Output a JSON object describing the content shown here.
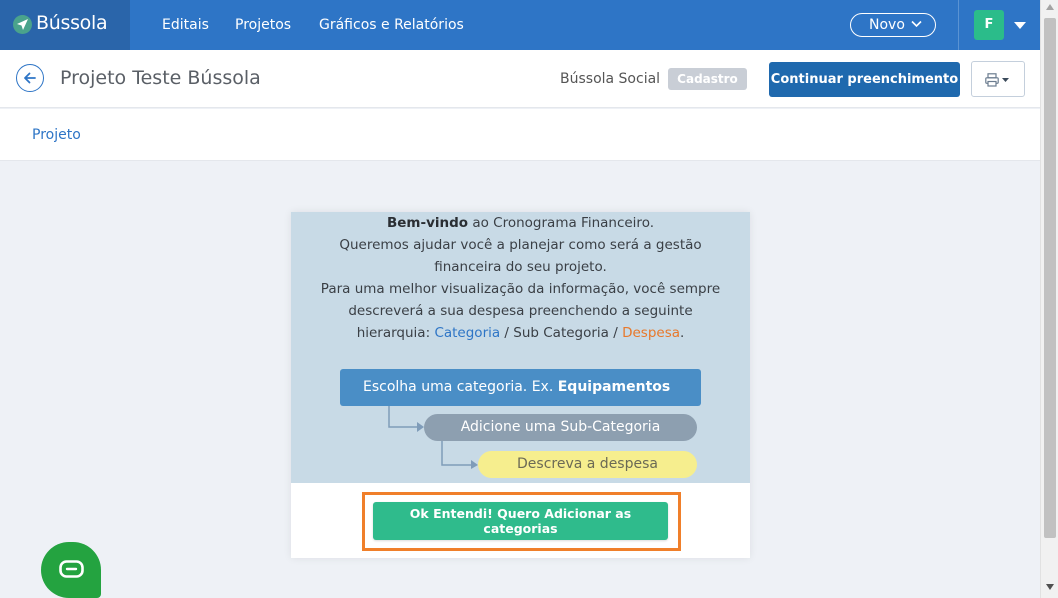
{
  "app": {
    "brand_name": "Bússola",
    "brand_color": "#2e75c6"
  },
  "navbar": {
    "links": [
      {
        "label": "Editais"
      },
      {
        "label": "Projetos"
      },
      {
        "label": "Gráficos e Relatórios"
      }
    ],
    "new_button_label": "Novo",
    "user_initial": "F",
    "icons": [
      "compass-logo-icon",
      "chevron-down-icon",
      "caret-down-icon"
    ]
  },
  "subheader": {
    "title": "Projeto Teste Bússola",
    "organization": "Bússola Social",
    "status_badge": "Cadastro",
    "continue_button": "Continuar preenchimento",
    "icons": [
      "back-arrow-icon",
      "printer-icon"
    ]
  },
  "tabs": [
    {
      "label": "Projeto"
    }
  ],
  "modal": {
    "intro": {
      "line1_bold": "Bem-vindo",
      "line1_rest": " ao Cronograma Financeiro.",
      "line2": "Queremos ajudar você a planejar como será a gestão financeira do seu projeto.",
      "line3": "Para uma melhor visualização da informação, você sempre descreverá a sua despesa preenchendo a seguinte hierarquia: ",
      "hier_category": "Categoria",
      "hier_sep1": " / Sub Categoria / ",
      "hier_expense": "Despesa",
      "hier_end": "."
    },
    "steps": {
      "step1_prefix": "Escolha uma categoria. Ex. ",
      "step1_bold": "Equipamentos",
      "step2": "Adicione uma Sub-Categoria",
      "step3": "Descreva a despesa"
    },
    "cta_button": "Ok Entendi! Quero Adicionar as categorias",
    "colors": {
      "category": "#2e75c6",
      "expense": "#e8782a",
      "cta": "#2fbb8c",
      "highlight_frame": "#f07f2a"
    }
  },
  "chat": {
    "icon": "chat-bubble-icon",
    "color": "#24a340"
  }
}
